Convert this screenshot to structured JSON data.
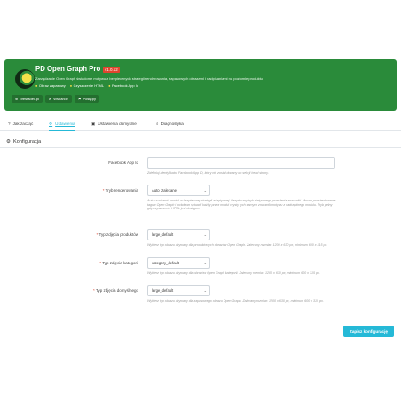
{
  "app": {
    "title": "PD Open Graph Pro",
    "version": "v1.0.12",
    "description": "Zarządzanie Open Graph świadome motywu z bezpiecznych strategii renderowania, zapasowych obrazami i nadpisaniami na poziomie produktu",
    "features": [
      "Obraz zapasowy",
      "Czyszczenie HTML",
      "Facebook App Id"
    ],
    "links": [
      {
        "label": "prestadev.pl",
        "icon": "globe-icon"
      },
      {
        "label": "Wsparcie",
        "icon": "envelope-icon"
      },
      {
        "label": "Postępy",
        "icon": "flag-icon"
      }
    ],
    "colors": {
      "banner": "#2a8b3a",
      "accent": "#25b9d7",
      "badge": "#e0452f",
      "required": "#e0452f"
    }
  },
  "tabs": [
    {
      "label": "Jak zacząć",
      "icon": "help-circle-icon"
    },
    {
      "label": "Ustawienia",
      "icon": "gears-icon",
      "active": true
    },
    {
      "label": "Ustawienia domyślne",
      "icon": "image-icon"
    },
    {
      "label": "Diagnostyka",
      "icon": "search-icon"
    }
  ],
  "section": {
    "title": "Konfiguracja",
    "icon": "gears-icon"
  },
  "form": {
    "app_id": {
      "label": "Facebook App Id",
      "value": "",
      "help": "Zdefiniuj identyfikator Facebook App ID, który nie został dodany do sekcji head strony."
    },
    "render_mode": {
      "label": "Tryb renderowania",
      "required": "*",
      "value": "Auto (zalecane)",
      "help": "Auto uruchamia moduł w bezpiecznej strategii adaptywnej. Bezpieczny tryb statycznego przesłania znaczniki. Mocne podstawiowanie tagów Open Graph i lockdown sytuacji każdy przez moduł czysty tych samych znacznik motywu z nadrzędnego modułu. Tryb pełny gdy czyszczenie HTML jest dostępne."
    },
    "product_image": {
      "label": "Typ zdjęcia produktów",
      "required": "*",
      "value": "large_default",
      "help": "Wybierz typ obrazu używany dla produktowych obrazów Open Graph. Zalecany rozmiar: 1200 x 630 px, minimum 600 x 315 px."
    },
    "category_image": {
      "label": "Typ zdjęcia kategorii",
      "required": "*",
      "value": "category_default",
      "help": "Wybierz typ obrazu używany dla obrazów Open Graph kategorii. Zalecany rozmiar: 1200 x 630 px, minimum 600 x 315 px."
    },
    "default_image": {
      "label": "Typ zdjęcia domyślnego",
      "required": "*",
      "value": "large_default",
      "help": "Wybierz typ obrazu używany dla zapasowego obrazu Open Graph. Zalecany rozmiar: 1200 x 630 px, minimum 600 x 315 px."
    }
  },
  "save_label": "Zapisz konfigurację"
}
